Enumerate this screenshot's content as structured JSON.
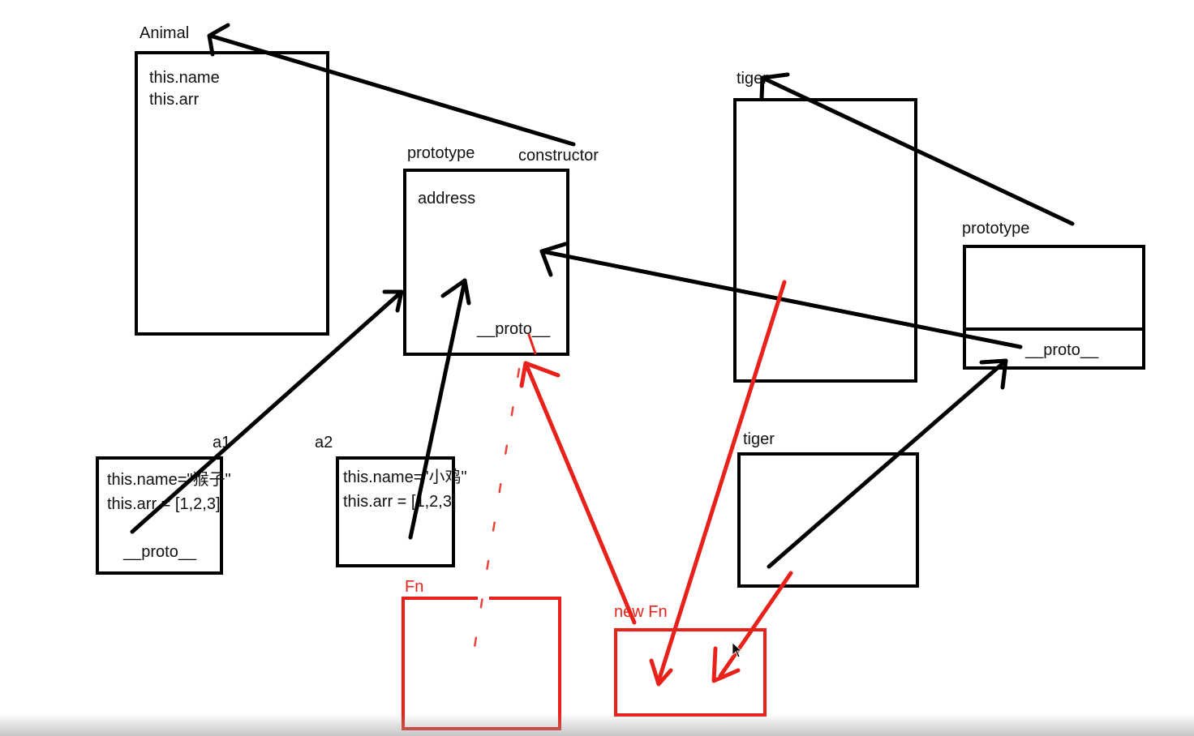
{
  "labels": {
    "animal": "Animal",
    "animal_this_name": "this.name",
    "animal_this_arr": "this.arr",
    "prototype_left": "prototype",
    "constructor": "constructor",
    "address": "address",
    "proto_center": "__proto__",
    "tiger_top": "tiger",
    "prototype_right": "prototype",
    "proto_right": "__proto__",
    "tiger_lower": "tiger",
    "a1": "a1",
    "a1_name": "this.name=\"猴子\"",
    "a1_arr": "this.arr = [1,2,3]",
    "a1_proto": "__proto__",
    "a2": "a2",
    "a2_name": "this.name=\"小鸡\"",
    "a2_arr": "this.arr = [1,2,3]",
    "fn": "Fn",
    "new_fn": "new Fn"
  },
  "colors": {
    "ink": "#000000",
    "red": "#e8221b"
  }
}
